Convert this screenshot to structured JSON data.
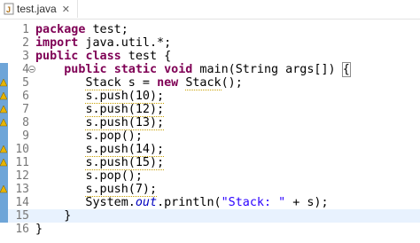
{
  "tab": {
    "title": "test.java",
    "close_glyph": "✕"
  },
  "lines": [
    {
      "n": "1",
      "tokens": [
        {
          "t": "package",
          "c": "kw"
        },
        {
          "t": " test;"
        }
      ]
    },
    {
      "n": "2",
      "tokens": [
        {
          "t": "import",
          "c": "kw"
        },
        {
          "t": " java.util.*;"
        }
      ]
    },
    {
      "n": "3",
      "tokens": [
        {
          "t": "public",
          "c": "kw"
        },
        {
          "t": " "
        },
        {
          "t": "class",
          "c": "kw"
        },
        {
          "t": " test {"
        }
      ]
    },
    {
      "n": "4",
      "tokens": [
        {
          "t": "    "
        },
        {
          "t": "public",
          "c": "kw"
        },
        {
          "t": " "
        },
        {
          "t": "static",
          "c": "kw"
        },
        {
          "t": " "
        },
        {
          "t": "void",
          "c": "kw"
        },
        {
          "t": " main(String args[]) "
        },
        {
          "t": "{",
          "c": "brace-hl"
        }
      ]
    },
    {
      "n": "5",
      "tokens": [
        {
          "t": "       "
        },
        {
          "t": "Stack",
          "c": "warn"
        },
        {
          "t": " s = "
        },
        {
          "t": "new",
          "c": "kw"
        },
        {
          "t": " "
        },
        {
          "t": "Stack",
          "c": "warn"
        },
        {
          "t": "();"
        }
      ]
    },
    {
      "n": "6",
      "tokens": [
        {
          "t": "       "
        },
        {
          "t": "s.push(10);",
          "c": "warn"
        }
      ]
    },
    {
      "n": "7",
      "tokens": [
        {
          "t": "       "
        },
        {
          "t": "s.push(12);",
          "c": "warn"
        }
      ]
    },
    {
      "n": "8",
      "tokens": [
        {
          "t": "       "
        },
        {
          "t": "s.push(13);",
          "c": "warn"
        }
      ]
    },
    {
      "n": "9",
      "tokens": [
        {
          "t": "       "
        },
        {
          "t": "s.pop();"
        }
      ]
    },
    {
      "n": "10",
      "tokens": [
        {
          "t": "       "
        },
        {
          "t": "s.push(14);",
          "c": "warn"
        }
      ]
    },
    {
      "n": "11",
      "tokens": [
        {
          "t": "       "
        },
        {
          "t": "s.push(15);",
          "c": "warn"
        }
      ]
    },
    {
      "n": "12",
      "tokens": [
        {
          "t": "       "
        },
        {
          "t": "s.pop();"
        }
      ]
    },
    {
      "n": "13",
      "tokens": [
        {
          "t": "       "
        },
        {
          "t": "s.push(7);",
          "c": "warn"
        }
      ]
    },
    {
      "n": "14",
      "tokens": [
        {
          "t": "       System."
        },
        {
          "t": "out",
          "c": "static"
        },
        {
          "t": ".println("
        },
        {
          "t": "\"Stack: \"",
          "c": "str"
        },
        {
          "t": " + s);"
        }
      ]
    },
    {
      "n": "15",
      "tokens": [
        {
          "t": "    }"
        }
      ]
    },
    {
      "n": "16",
      "tokens": [
        {
          "t": "}"
        }
      ]
    }
  ],
  "gutter": {
    "changed_lines": [
      4,
      5,
      6,
      7,
      8,
      9,
      10,
      11,
      12,
      13,
      14,
      15
    ],
    "warning_lines": [
      5,
      6,
      7,
      8,
      10,
      11,
      13
    ],
    "fold_line": 4,
    "current_line": 15,
    "ruler_color": "#6ea5d8",
    "warning_color": "#e8b400"
  },
  "colors": {
    "keyword": "#7f0055",
    "string": "#2a00ff",
    "static_field": "#0000c0",
    "current_line_bg": "#e8f2fe"
  }
}
